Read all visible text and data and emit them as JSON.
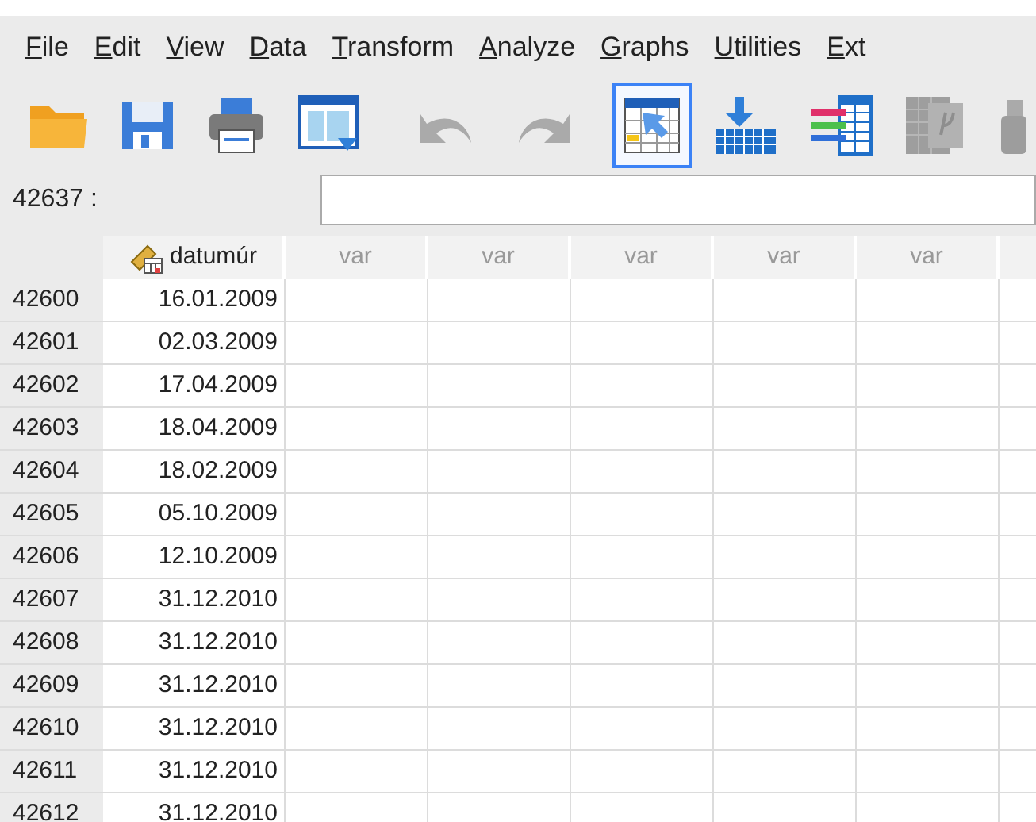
{
  "menu": [
    {
      "label": "File"
    },
    {
      "label": "Edit"
    },
    {
      "label": "View"
    },
    {
      "label": "Data"
    },
    {
      "label": "Transform"
    },
    {
      "label": "Analyze"
    },
    {
      "label": "Graphs"
    },
    {
      "label": "Utilities"
    },
    {
      "label": "Ext"
    }
  ],
  "toolbar": [
    {
      "kind": "open",
      "selected": false,
      "disabled": false
    },
    {
      "kind": "save",
      "selected": false,
      "disabled": false
    },
    {
      "kind": "print",
      "selected": false,
      "disabled": false
    },
    {
      "kind": "dialog",
      "selected": false,
      "disabled": false
    },
    {
      "kind": "undo",
      "selected": false,
      "disabled": true
    },
    {
      "kind": "redo",
      "selected": false,
      "disabled": true
    },
    {
      "kind": "goto-case",
      "selected": true,
      "disabled": false
    },
    {
      "kind": "goto-variable",
      "selected": false,
      "disabled": false
    },
    {
      "kind": "variables",
      "selected": false,
      "disabled": false
    },
    {
      "kind": "stats",
      "selected": false,
      "disabled": true
    },
    {
      "kind": "find",
      "selected": false,
      "disabled": true
    }
  ],
  "cell_ref": {
    "label": "42637 :"
  },
  "grid": {
    "columns": [
      {
        "label": "datumúr",
        "kind": "variable"
      },
      {
        "label": "var",
        "kind": "empty"
      },
      {
        "label": "var",
        "kind": "empty"
      },
      {
        "label": "var",
        "kind": "empty"
      },
      {
        "label": "var",
        "kind": "empty"
      },
      {
        "label": "var",
        "kind": "empty"
      },
      {
        "kind": "empty"
      }
    ],
    "rows": [
      {
        "case": "42600",
        "cells": [
          "16.01.2009"
        ]
      },
      {
        "case": "42601",
        "cells": [
          "02.03.2009"
        ]
      },
      {
        "case": "42602",
        "cells": [
          "17.04.2009"
        ]
      },
      {
        "case": "42603",
        "cells": [
          "18.04.2009"
        ]
      },
      {
        "case": "42604",
        "cells": [
          "18.02.2009"
        ]
      },
      {
        "case": "42605",
        "cells": [
          "05.10.2009"
        ]
      },
      {
        "case": "42606",
        "cells": [
          "12.10.2009"
        ]
      },
      {
        "case": "42607",
        "cells": [
          "31.12.2010"
        ]
      },
      {
        "case": "42608",
        "cells": [
          "31.12.2010"
        ]
      },
      {
        "case": "42609",
        "cells": [
          "31.12.2010"
        ]
      },
      {
        "case": "42610",
        "cells": [
          "31.12.2010"
        ]
      },
      {
        "case": "42611",
        "cells": [
          "31.12.2010"
        ]
      },
      {
        "case": "42612",
        "cells": [
          "31.12.2010"
        ]
      }
    ]
  }
}
